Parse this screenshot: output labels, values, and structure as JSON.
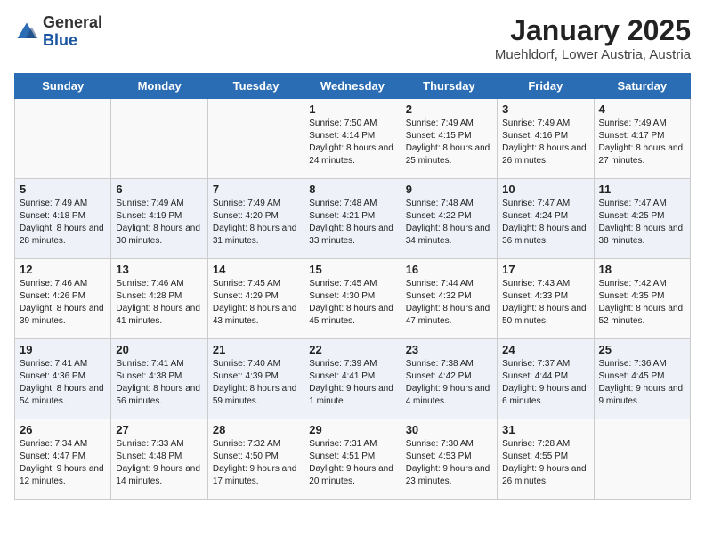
{
  "logo": {
    "general": "General",
    "blue": "Blue"
  },
  "title": "January 2025",
  "subtitle": "Muehldorf, Lower Austria, Austria",
  "weekdays": [
    "Sunday",
    "Monday",
    "Tuesday",
    "Wednesday",
    "Thursday",
    "Friday",
    "Saturday"
  ],
  "weeks": [
    [
      {
        "day": "",
        "sunrise": "",
        "sunset": "",
        "daylight": ""
      },
      {
        "day": "",
        "sunrise": "",
        "sunset": "",
        "daylight": ""
      },
      {
        "day": "",
        "sunrise": "",
        "sunset": "",
        "daylight": ""
      },
      {
        "day": "1",
        "sunrise": "Sunrise: 7:50 AM",
        "sunset": "Sunset: 4:14 PM",
        "daylight": "Daylight: 8 hours and 24 minutes."
      },
      {
        "day": "2",
        "sunrise": "Sunrise: 7:49 AM",
        "sunset": "Sunset: 4:15 PM",
        "daylight": "Daylight: 8 hours and 25 minutes."
      },
      {
        "day": "3",
        "sunrise": "Sunrise: 7:49 AM",
        "sunset": "Sunset: 4:16 PM",
        "daylight": "Daylight: 8 hours and 26 minutes."
      },
      {
        "day": "4",
        "sunrise": "Sunrise: 7:49 AM",
        "sunset": "Sunset: 4:17 PM",
        "daylight": "Daylight: 8 hours and 27 minutes."
      }
    ],
    [
      {
        "day": "5",
        "sunrise": "Sunrise: 7:49 AM",
        "sunset": "Sunset: 4:18 PM",
        "daylight": "Daylight: 8 hours and 28 minutes."
      },
      {
        "day": "6",
        "sunrise": "Sunrise: 7:49 AM",
        "sunset": "Sunset: 4:19 PM",
        "daylight": "Daylight: 8 hours and 30 minutes."
      },
      {
        "day": "7",
        "sunrise": "Sunrise: 7:49 AM",
        "sunset": "Sunset: 4:20 PM",
        "daylight": "Daylight: 8 hours and 31 minutes."
      },
      {
        "day": "8",
        "sunrise": "Sunrise: 7:48 AM",
        "sunset": "Sunset: 4:21 PM",
        "daylight": "Daylight: 8 hours and 33 minutes."
      },
      {
        "day": "9",
        "sunrise": "Sunrise: 7:48 AM",
        "sunset": "Sunset: 4:22 PM",
        "daylight": "Daylight: 8 hours and 34 minutes."
      },
      {
        "day": "10",
        "sunrise": "Sunrise: 7:47 AM",
        "sunset": "Sunset: 4:24 PM",
        "daylight": "Daylight: 8 hours and 36 minutes."
      },
      {
        "day": "11",
        "sunrise": "Sunrise: 7:47 AM",
        "sunset": "Sunset: 4:25 PM",
        "daylight": "Daylight: 8 hours and 38 minutes."
      }
    ],
    [
      {
        "day": "12",
        "sunrise": "Sunrise: 7:46 AM",
        "sunset": "Sunset: 4:26 PM",
        "daylight": "Daylight: 8 hours and 39 minutes."
      },
      {
        "day": "13",
        "sunrise": "Sunrise: 7:46 AM",
        "sunset": "Sunset: 4:28 PM",
        "daylight": "Daylight: 8 hours and 41 minutes."
      },
      {
        "day": "14",
        "sunrise": "Sunrise: 7:45 AM",
        "sunset": "Sunset: 4:29 PM",
        "daylight": "Daylight: 8 hours and 43 minutes."
      },
      {
        "day": "15",
        "sunrise": "Sunrise: 7:45 AM",
        "sunset": "Sunset: 4:30 PM",
        "daylight": "Daylight: 8 hours and 45 minutes."
      },
      {
        "day": "16",
        "sunrise": "Sunrise: 7:44 AM",
        "sunset": "Sunset: 4:32 PM",
        "daylight": "Daylight: 8 hours and 47 minutes."
      },
      {
        "day": "17",
        "sunrise": "Sunrise: 7:43 AM",
        "sunset": "Sunset: 4:33 PM",
        "daylight": "Daylight: 8 hours and 50 minutes."
      },
      {
        "day": "18",
        "sunrise": "Sunrise: 7:42 AM",
        "sunset": "Sunset: 4:35 PM",
        "daylight": "Daylight: 8 hours and 52 minutes."
      }
    ],
    [
      {
        "day": "19",
        "sunrise": "Sunrise: 7:41 AM",
        "sunset": "Sunset: 4:36 PM",
        "daylight": "Daylight: 8 hours and 54 minutes."
      },
      {
        "day": "20",
        "sunrise": "Sunrise: 7:41 AM",
        "sunset": "Sunset: 4:38 PM",
        "daylight": "Daylight: 8 hours and 56 minutes."
      },
      {
        "day": "21",
        "sunrise": "Sunrise: 7:40 AM",
        "sunset": "Sunset: 4:39 PM",
        "daylight": "Daylight: 8 hours and 59 minutes."
      },
      {
        "day": "22",
        "sunrise": "Sunrise: 7:39 AM",
        "sunset": "Sunset: 4:41 PM",
        "daylight": "Daylight: 9 hours and 1 minute."
      },
      {
        "day": "23",
        "sunrise": "Sunrise: 7:38 AM",
        "sunset": "Sunset: 4:42 PM",
        "daylight": "Daylight: 9 hours and 4 minutes."
      },
      {
        "day": "24",
        "sunrise": "Sunrise: 7:37 AM",
        "sunset": "Sunset: 4:44 PM",
        "daylight": "Daylight: 9 hours and 6 minutes."
      },
      {
        "day": "25",
        "sunrise": "Sunrise: 7:36 AM",
        "sunset": "Sunset: 4:45 PM",
        "daylight": "Daylight: 9 hours and 9 minutes."
      }
    ],
    [
      {
        "day": "26",
        "sunrise": "Sunrise: 7:34 AM",
        "sunset": "Sunset: 4:47 PM",
        "daylight": "Daylight: 9 hours and 12 minutes."
      },
      {
        "day": "27",
        "sunrise": "Sunrise: 7:33 AM",
        "sunset": "Sunset: 4:48 PM",
        "daylight": "Daylight: 9 hours and 14 minutes."
      },
      {
        "day": "28",
        "sunrise": "Sunrise: 7:32 AM",
        "sunset": "Sunset: 4:50 PM",
        "daylight": "Daylight: 9 hours and 17 minutes."
      },
      {
        "day": "29",
        "sunrise": "Sunrise: 7:31 AM",
        "sunset": "Sunset: 4:51 PM",
        "daylight": "Daylight: 9 hours and 20 minutes."
      },
      {
        "day": "30",
        "sunrise": "Sunrise: 7:30 AM",
        "sunset": "Sunset: 4:53 PM",
        "daylight": "Daylight: 9 hours and 23 minutes."
      },
      {
        "day": "31",
        "sunrise": "Sunrise: 7:28 AM",
        "sunset": "Sunset: 4:55 PM",
        "daylight": "Daylight: 9 hours and 26 minutes."
      },
      {
        "day": "",
        "sunrise": "",
        "sunset": "",
        "daylight": ""
      }
    ]
  ]
}
